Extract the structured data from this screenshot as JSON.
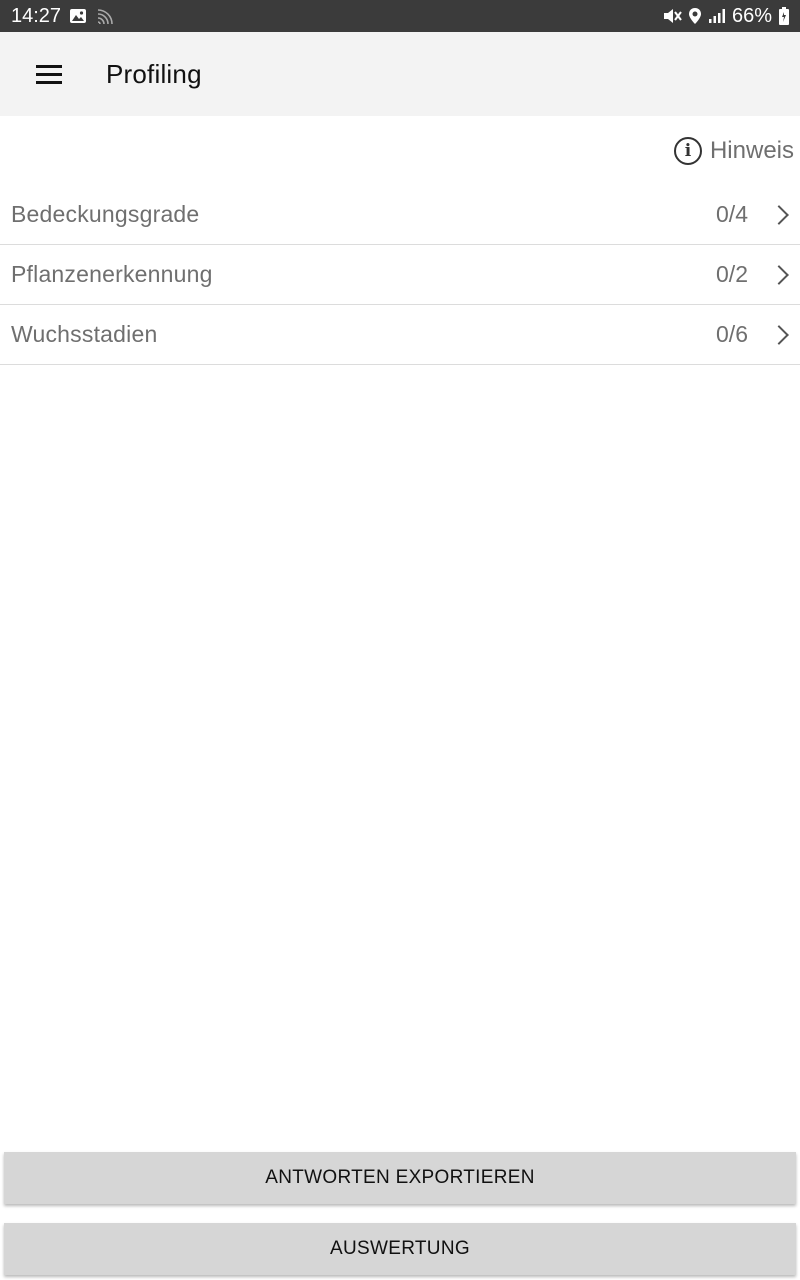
{
  "status_bar": {
    "time": "14:27",
    "battery": "66%",
    "icons_left": [
      "image-icon",
      "cast-icon"
    ],
    "icons_right": [
      "mute-icon",
      "location-icon",
      "signal-icon",
      "battery-icon"
    ]
  },
  "app_bar": {
    "title": "Profiling",
    "menu_icon": "menu-icon"
  },
  "hint": {
    "label": "Hinweis",
    "icon": "info-icon"
  },
  "list": {
    "items": [
      {
        "label": "Bedeckungsgrade",
        "count": "0/4"
      },
      {
        "label": "Pflanzenerkennung",
        "count": "0/2"
      },
      {
        "label": "Wuchsstadien",
        "count": "0/6"
      }
    ]
  },
  "buttons": {
    "export_label": "ANTWORTEN EXPORTIEREN",
    "evaluation_label": "AUSWERTUNG"
  },
  "colors": {
    "status_bar_bg": "#3b3b3b",
    "app_bar_bg": "#f3f3f3",
    "button_bg": "#d6d6d6",
    "secondary_text": "#6f6f6f"
  }
}
